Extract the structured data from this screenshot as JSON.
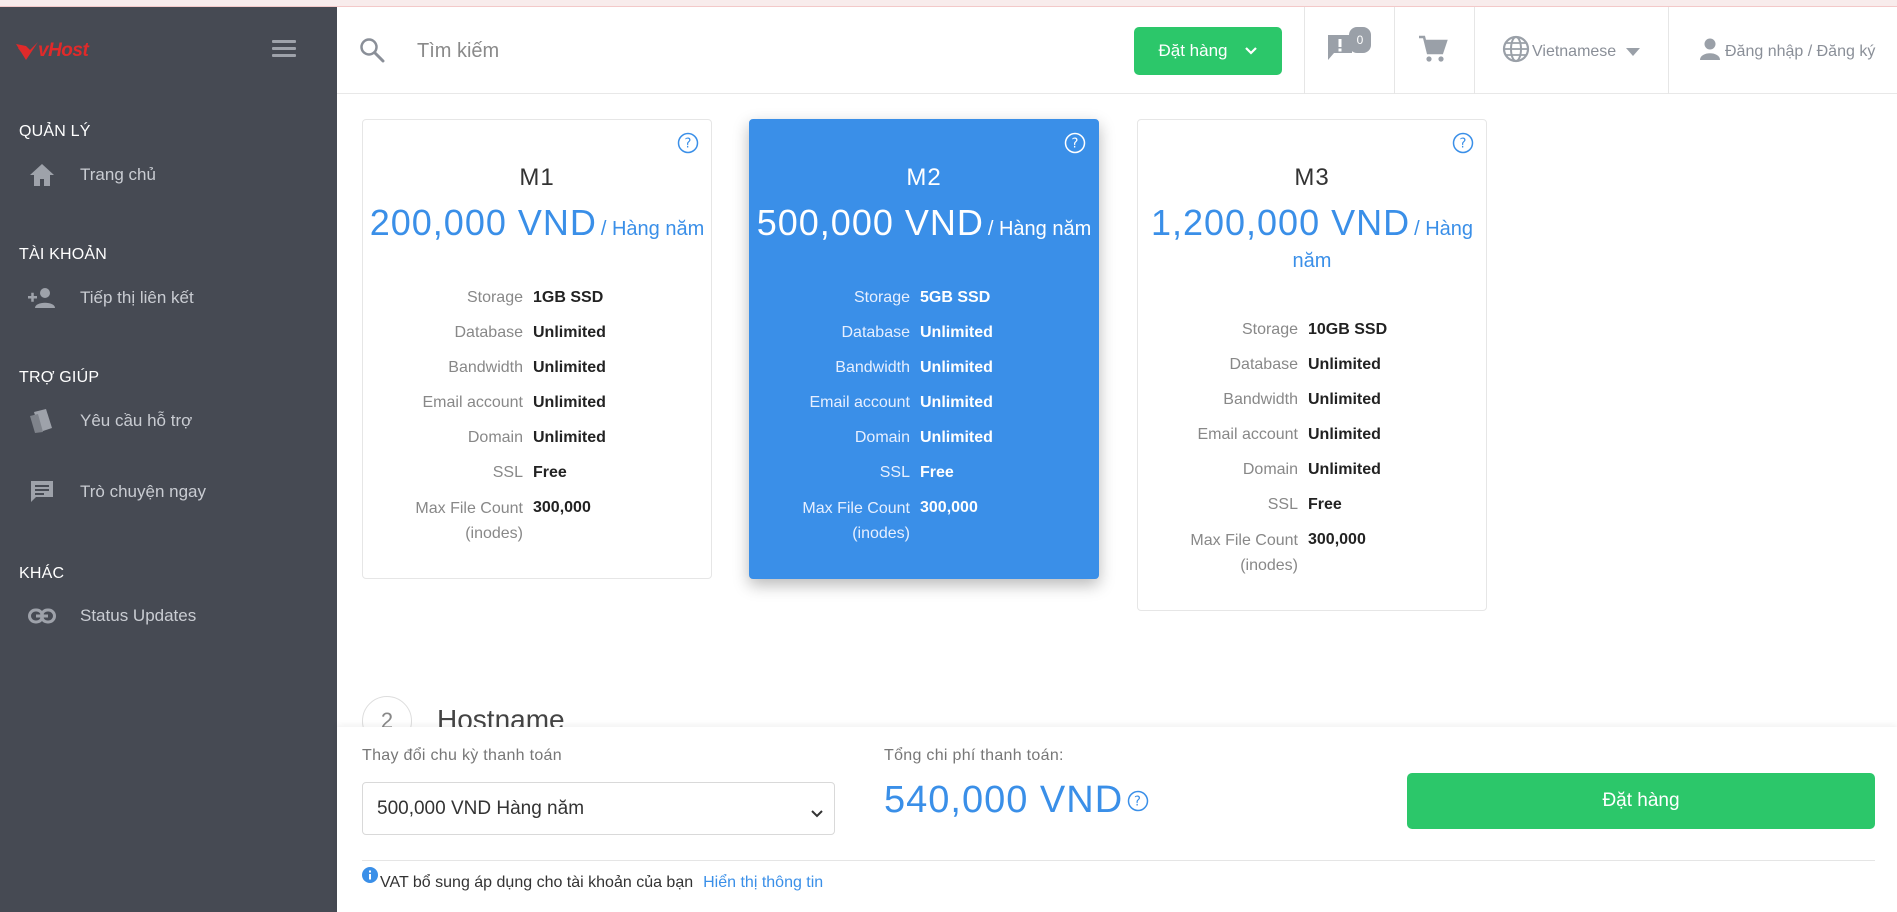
{
  "brand": {
    "logo_text": "vHost",
    "accent": "#e02a2a"
  },
  "sidebar": {
    "sections": [
      {
        "title": "QUẢN LÝ",
        "items": [
          {
            "label": "Trang chủ",
            "icon": "home-icon"
          }
        ]
      },
      {
        "title": "TÀI KHOẢN",
        "items": [
          {
            "label": "Tiếp thị liên kết",
            "icon": "user-plus-icon"
          }
        ]
      },
      {
        "title": "TRỢ GIÚP",
        "items": [
          {
            "label": "Yêu cầu hỗ trợ",
            "icon": "ticket-icon"
          },
          {
            "label": "Trò chuyện ngay",
            "icon": "chat-icon"
          }
        ]
      },
      {
        "title": "KHÁC",
        "items": [
          {
            "label": "Status Updates",
            "icon": "link-icon"
          }
        ]
      }
    ]
  },
  "header": {
    "search_placeholder": "Tìm kiếm",
    "order_label": "Đặt hàng",
    "notification_count": "0",
    "language": "Vietnamese",
    "login_label": "Đăng nhập / Đăng ký"
  },
  "plans": [
    {
      "name": "M1",
      "price": "200,000 VND",
      "period": "/ Hàng năm",
      "selected": false,
      "specs": [
        {
          "k": "Storage",
          "v": "1GB SSD"
        },
        {
          "k": "Database",
          "v": "Unlimited"
        },
        {
          "k": "Bandwidth",
          "v": "Unlimited"
        },
        {
          "k": "Email account",
          "v": "Unlimited"
        },
        {
          "k": "Domain",
          "v": "Unlimited"
        },
        {
          "k": "SSL",
          "v": "Free"
        },
        {
          "k": "Max File Count (inodes)",
          "v": "300,000"
        }
      ]
    },
    {
      "name": "M2",
      "price": "500,000 VND",
      "period": "/ Hàng năm",
      "selected": true,
      "specs": [
        {
          "k": "Storage",
          "v": "5GB SSD"
        },
        {
          "k": "Database",
          "v": "Unlimited"
        },
        {
          "k": "Bandwidth",
          "v": "Unlimited"
        },
        {
          "k": "Email account",
          "v": "Unlimited"
        },
        {
          "k": "Domain",
          "v": "Unlimited"
        },
        {
          "k": "SSL",
          "v": "Free"
        },
        {
          "k": "Max File Count (inodes)",
          "v": "300,000"
        }
      ]
    },
    {
      "name": "M3",
      "price": "1,200,000 VND",
      "period": "/ Hàng năm",
      "selected": false,
      "specs": [
        {
          "k": "Storage",
          "v": "10GB SSD"
        },
        {
          "k": "Database",
          "v": "Unlimited"
        },
        {
          "k": "Bandwidth",
          "v": "Unlimited"
        },
        {
          "k": "Email account",
          "v": "Unlimited"
        },
        {
          "k": "Domain",
          "v": "Unlimited"
        },
        {
          "k": "SSL",
          "v": "Free"
        },
        {
          "k": "Max File Count (inodes)",
          "v": "300,000"
        }
      ]
    }
  ],
  "step": {
    "number": "2",
    "title": "Hostname"
  },
  "bottom": {
    "cycle_label": "Thay đổi chu kỳ thanh toán",
    "cycle_selected": "500,000 VND Hàng năm",
    "total_label": "Tổng chi phí thanh toán:",
    "total_value": "540,000 VND",
    "checkout_label": "Đặt hàng",
    "vat_text": "VAT bổ sung áp dụng cho tài khoản của bạn",
    "vat_link": "Hiển thị thông tin"
  },
  "colors": {
    "green": "#2cc76a",
    "blue": "#3a8fe8",
    "sidebar": "#464a53"
  }
}
